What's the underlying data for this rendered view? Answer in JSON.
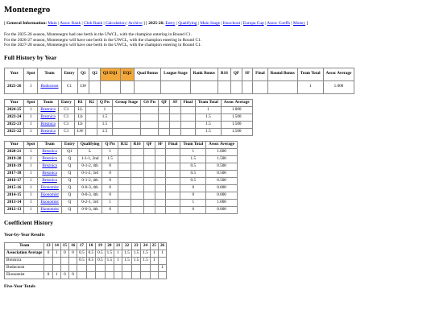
{
  "title": "Montenegro",
  "nav": {
    "general_label": "General Information:",
    "general_links": [
      "Main",
      "Assoc Rank",
      "Club Rank",
      "Calculation",
      "Archive"
    ],
    "season_label": "2025-26:",
    "season_links": [
      "Entry",
      "Qualifying",
      "Main Stage",
      "Knockout",
      "Europa Cup",
      "Assoc Coeffs",
      "Money"
    ]
  },
  "notes": [
    "For the 2025-26 season, Montenegro had one berth in the UWCL, with the champion entering in Round C1.",
    "For the 2026-27 season, Montenegro will have one berth in the UWCL, with the champion entering in Round C1.",
    "For the 2027-28 season, Montenegro will have one berth in the UWCL, with the champion entering in Round C1."
  ],
  "history_heading": "Full History by Year",
  "table1": {
    "headers": [
      "Year",
      "Spot",
      "Team",
      "Entry",
      "Q1",
      "Q2",
      "Q3 EQ1",
      "EQ2",
      "Qual Bonus",
      "League Stage",
      "Rank Bonus",
      "R16",
      "QF",
      "SF",
      "Final",
      "Round Bonus",
      "Team Total",
      "Assoc Average"
    ],
    "rows": [
      [
        "2025-26",
        "1",
        "Buducnost",
        "C1",
        "LW",
        "",
        "",
        "",
        "",
        "",
        "",
        "",
        "",
        "",
        "",
        "",
        "1",
        "1.000"
      ]
    ]
  },
  "table2": {
    "headers": [
      "Year",
      "Spot",
      "Team",
      "Entry",
      "R1",
      "R2",
      "Q Pts",
      "Group Stage",
      "GS Pts",
      "QF",
      "SF",
      "Final",
      "Team Total",
      "Assoc Average"
    ],
    "rows": [
      [
        "2024-25",
        "1",
        "Breznica",
        "C1",
        "LL",
        "",
        "1",
        "",
        "",
        "",
        "",
        "",
        "1",
        "1.000"
      ],
      [
        "2023-24",
        "1",
        "Breznica",
        "C1",
        "Lb",
        "",
        "1.5",
        "",
        "",
        "",
        "",
        "",
        "1.5",
        "1.500"
      ],
      [
        "2022-23",
        "1",
        "Breznica",
        "C1",
        "Lb",
        "",
        "1.5",
        "",
        "",
        "",
        "",
        "",
        "1.5",
        "1.500"
      ],
      [
        "2021-22",
        "1",
        "Breznica",
        "C1",
        "LW",
        "",
        "1.5",
        "",
        "",
        "",
        "",
        "",
        "1.5",
        "1.500"
      ]
    ]
  },
  "table3": {
    "headers": [
      "Year",
      "Spot",
      "Team",
      "Entry",
      "Qualifying",
      "Q Pts",
      "R32",
      "R16",
      "QF",
      "SF",
      "Final",
      "Team Total",
      "Assoc Average"
    ],
    "rows": [
      [
        "2020-21",
        "1",
        "Breznica",
        "Q1",
        "L",
        "1",
        "",
        "",
        "",
        "",
        "",
        "1",
        "1.000"
      ],
      [
        "2019-20",
        "1",
        "Breznica",
        "Q",
        "1-1-1, 2nd",
        "1.5",
        "",
        "",
        "",
        "",
        "",
        "1.5",
        "1.500"
      ],
      [
        "2018-19",
        "1",
        "Breznica",
        "Q",
        "0-1-2, 4th",
        "0",
        "",
        "",
        "",
        "",
        "",
        "0.5",
        "0.500"
      ],
      [
        "2017-18",
        "1",
        "Breznica",
        "Q",
        "0-1-2, 3rd",
        "0",
        "",
        "",
        "",
        "",
        "",
        "0.5",
        "0.500"
      ],
      [
        "2016-17",
        "1",
        "Breznica",
        "Q",
        "0-1-2, 4th",
        "0",
        "",
        "",
        "",
        "",
        "",
        "0.5",
        "0.500"
      ],
      [
        "2015-16",
        "1",
        "Ekonomist",
        "Q",
        "0-0-3, 4th",
        "0",
        "",
        "",
        "",
        "",
        "",
        "0",
        "0.000"
      ],
      [
        "2014-15",
        "1",
        "Ekonomist",
        "Q",
        "0-0-3, 4th",
        "0",
        "",
        "",
        "",
        "",
        "",
        "0",
        "0.000"
      ],
      [
        "2013-14",
        "1",
        "Ekonomist",
        "Q",
        "0-2-1, 3rd",
        "1",
        "",
        "",
        "",
        "",
        "",
        "1",
        "1.000"
      ],
      [
        "2012-13",
        "1",
        "Ekonomist",
        "Q",
        "0-0-3, 4th",
        "0",
        "",
        "",
        "",
        "",
        "",
        "0",
        "0.000"
      ]
    ]
  },
  "coef_heading": "Coefficient History",
  "yby_heading": "Year-by-Year Results",
  "table5": {
    "headers": [
      "Team",
      "13",
      "14",
      "15",
      "16",
      "17",
      "18",
      "19",
      "20",
      "21",
      "22",
      "23",
      "24",
      "25",
      "26"
    ],
    "rows": [
      [
        "Association Average",
        "0",
        "1",
        "0",
        "0",
        "0.5",
        "0.5",
        "0.5",
        "1.5",
        "1",
        "1.5",
        "1.5",
        "1.5",
        "1",
        "1"
      ],
      [
        "Breznica",
        "",
        "",
        "",
        "",
        "0.5",
        "0.5",
        "0.5",
        "1.5",
        "1",
        "1.5",
        "1.5",
        "1.5",
        "1",
        ""
      ],
      [
        "Buducnost",
        "",
        "",
        "",
        "",
        "",
        "",
        "",
        "",
        "",
        "",
        "",
        "",
        "",
        "1"
      ],
      [
        "Ekonomist",
        "0",
        "1",
        "0",
        "0",
        "",
        "",
        "",
        "",
        "",
        "",
        "",
        "",
        "",
        ""
      ]
    ]
  },
  "five_year_heading": "Five-Year Totals",
  "highlight_color": "#f2a83a",
  "link_color": "#0000ee"
}
